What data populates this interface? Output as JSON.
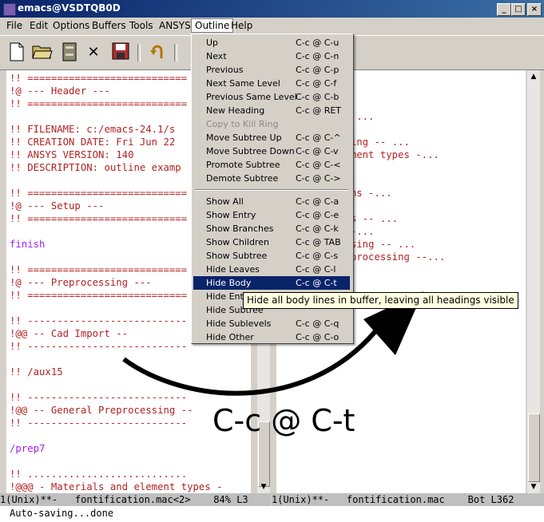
{
  "window": {
    "title": "emacs@VSDTQB0D",
    "min_label": "_",
    "max_label": "□",
    "close_label": "×"
  },
  "menubar": {
    "items": [
      "File",
      "Edit",
      "Options",
      "Buffers",
      "Tools",
      "ANSYS",
      "Outline",
      "Help"
    ]
  },
  "toolbar": {
    "icons": [
      "new-file-icon",
      "open-folder-icon",
      "dired-icon",
      "close-buffer-icon",
      "save-icon",
      "undo-icon"
    ]
  },
  "left_pane": {
    "lines": [
      "!! ===========================",
      "!@ --- Header ---",
      "!! ===========================",
      "",
      "!! FILENAME: c:/emacs-24.1/s",
      "!! CREATION DATE: Fri Jun 22",
      "!! ANSYS VERSION: 140",
      "!! DESCRIPTION: outline examp",
      "",
      "!! ===========================",
      "!@ --- Setup ---",
      "!! ===========================",
      "",
      "finish",
      "",
      "!! ===========================",
      "!@ --- Preprocessing ---",
      "!! ===========================",
      "",
      "!! ---------------------------",
      "!@@ -- Cad Import --",
      "!! ---------------------------",
      "",
      "!! /aux15",
      "",
      "!! ---------------------------",
      "!@@ -- General Preprocessing --",
      "!! ---------------------------",
      "",
      "/prep7",
      "",
      "!! ...........................",
      "!@@@ - Materials and element types -",
      "!! ..........................."
    ]
  },
  "right_pane": {
    "lines": [
      "",
      "r ---...",
      " ---...",
      "ocessing --- ...",
      "mport -- ...",
      "l Preprocessing -- ...",
      "ials and element types -...",
      "try -...",
      "g -...",
      "ary conditions -...",
      "ion --- ...",
      "tion controls -- ...",
      "rocessing ---...",
      "l Postprocessing -- ...",
      "History Postprocessing --..."
    ]
  },
  "modeline_left": "1(Unix)**-   fontification.mac<2>    84% L3",
  "modeline_right": "1(Unix)**-   fontification.mac    Bot L362",
  "echo_area": "Auto-saving...done",
  "outline_menu": {
    "items": [
      {
        "label": "Up",
        "key": "C-c @ C-u",
        "state": "normal"
      },
      {
        "label": "Next",
        "key": "C-c @ C-n",
        "state": "normal"
      },
      {
        "label": "Previous",
        "key": "C-c @ C-p",
        "state": "normal"
      },
      {
        "label": "Next Same Level",
        "key": "C-c @ C-f",
        "state": "normal"
      },
      {
        "label": "Previous Same Level",
        "key": "C-c @ C-b",
        "state": "normal"
      },
      {
        "label": "New Heading",
        "key": "C-c @ RET",
        "state": "normal"
      },
      {
        "label": "Copy to Kill Ring",
        "key": "",
        "state": "disabled"
      },
      {
        "label": "Move Subtree Up",
        "key": "C-c @ C-^",
        "state": "normal"
      },
      {
        "label": "Move Subtree Down",
        "key": "C-c @ C-v",
        "state": "normal"
      },
      {
        "label": "Promote Subtree",
        "key": "C-c @ C-<",
        "state": "normal"
      },
      {
        "label": "Demote Subtree",
        "key": "C-c @ C->",
        "state": "normal"
      },
      {
        "label": "Show All",
        "key": "C-c @ C-a",
        "state": "normal"
      },
      {
        "label": "Show Entry",
        "key": "C-c @ C-e",
        "state": "normal"
      },
      {
        "label": "Show Branches",
        "key": "C-c @ C-k",
        "state": "normal"
      },
      {
        "label": "Show Children",
        "key": "C-c @ TAB",
        "state": "normal"
      },
      {
        "label": "Show Subtree",
        "key": "C-c @ C-s",
        "state": "normal"
      },
      {
        "label": "Hide Leaves",
        "key": "C-c @ C-l",
        "state": "normal"
      },
      {
        "label": "Hide Body",
        "key": "C-c @ C-t",
        "state": "highlighted"
      },
      {
        "label": "Hide Entry",
        "key": "",
        "state": "normal"
      },
      {
        "label": "Hide Subtree",
        "key": "",
        "state": "normal"
      },
      {
        "label": "Hide Sublevels",
        "key": "C-c @ C-q",
        "state": "normal"
      },
      {
        "label": "Hide Other",
        "key": "C-c @ C-o",
        "state": "normal"
      }
    ]
  },
  "tooltip": "Hide all body lines in buffer, leaving all headings visible",
  "annotation": "C-c @ C-t",
  "colors": {
    "comment": "#b22222",
    "keyword": "#a020f0",
    "menu_highlight": "#0a246a",
    "title_bar": "#0a246a"
  }
}
